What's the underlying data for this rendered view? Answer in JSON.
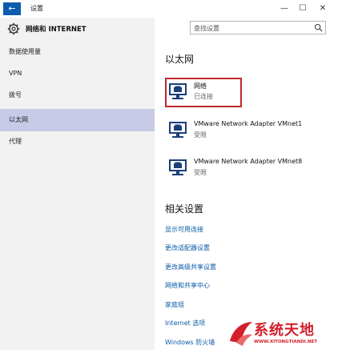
{
  "window": {
    "title": "设置",
    "back_glyph": "←",
    "minimize_glyph": "—",
    "maximize_glyph": "☐",
    "close_glyph": "✕"
  },
  "header": {
    "title": "网络和 INTERNET",
    "icon": "gear-icon"
  },
  "search": {
    "placeholder": "查找设置",
    "icon": "search-icon"
  },
  "sidebar": {
    "items": [
      {
        "label": "数据使用量",
        "active": false
      },
      {
        "label": "VPN",
        "active": false
      },
      {
        "label": "拨号",
        "active": false
      },
      {
        "label": "以太网",
        "active": true
      },
      {
        "label": "代理",
        "active": false
      }
    ]
  },
  "content": {
    "section_title": "以太网",
    "networks": [
      {
        "name": "网络",
        "status": "已连接",
        "icon": "network-monitor-icon",
        "selected": true
      },
      {
        "name": "VMware Network Adapter VMnet1",
        "status": "受限",
        "icon": "network-monitor-icon",
        "selected": false
      },
      {
        "name": "VMware Network Adapter VMnet8",
        "status": "受限",
        "icon": "network-monitor-icon",
        "selected": false
      }
    ],
    "related_title": "相关设置",
    "related_links": [
      "显示可用连接",
      "更改适配器设置",
      "更改高级共享设置",
      "网络和共享中心",
      "家庭组",
      "Internet 选项",
      "Windows 防火墙"
    ]
  },
  "watermark": {
    "title": "系统天地",
    "url": "WWW.XITONGTIANDI.NET"
  },
  "colors": {
    "accent": "#0b5cad",
    "sidebar_bg": "#f2f2f2",
    "active_bg": "#c7cbe8",
    "link": "#0a5aa8",
    "highlight": "#c0272d",
    "watermark": "#d21f2a"
  }
}
